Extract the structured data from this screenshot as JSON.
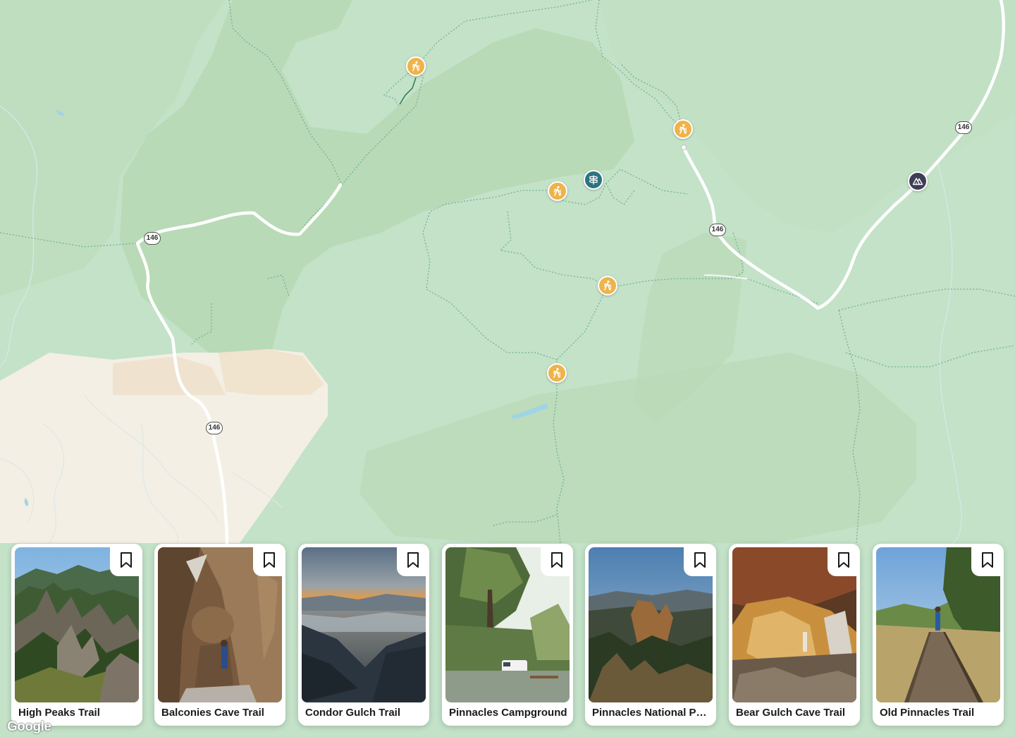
{
  "map": {
    "route_shield_label": "146",
    "markers": [
      {
        "type": "trail",
        "icon": "hiker-icon"
      },
      {
        "type": "trail",
        "icon": "hiker-icon"
      },
      {
        "type": "trail",
        "icon": "hiker-icon"
      },
      {
        "type": "trail",
        "icon": "hiker-icon"
      },
      {
        "type": "trail",
        "icon": "hiker-icon"
      },
      {
        "type": "trailhead",
        "icon": "signpost-icon"
      },
      {
        "type": "campground",
        "icon": "tent-icon"
      }
    ],
    "attribution": "Google",
    "colors": {
      "trail_marker": "#efb34a",
      "trailhead_marker": "#2e7480",
      "camp_marker": "#3d3f55",
      "park_land": "#c3e2c8",
      "forest": "#b7dbb5",
      "outside_land": "#f3efe4"
    }
  },
  "cards": [
    {
      "title": "High Peaks Trail",
      "bookmark_icon": "bookmark-icon"
    },
    {
      "title": "Balconies Cave Trail",
      "bookmark_icon": "bookmark-icon"
    },
    {
      "title": "Condor Gulch Trail",
      "bookmark_icon": "bookmark-icon"
    },
    {
      "title": "Pinnacles Campground",
      "bookmark_icon": "bookmark-icon"
    },
    {
      "title": "Pinnacles National Park",
      "bookmark_icon": "bookmark-icon"
    },
    {
      "title": "Bear Gulch Cave Trail",
      "bookmark_icon": "bookmark-icon"
    },
    {
      "title": "Old Pinnacles Trail",
      "bookmark_icon": "bookmark-icon"
    }
  ]
}
